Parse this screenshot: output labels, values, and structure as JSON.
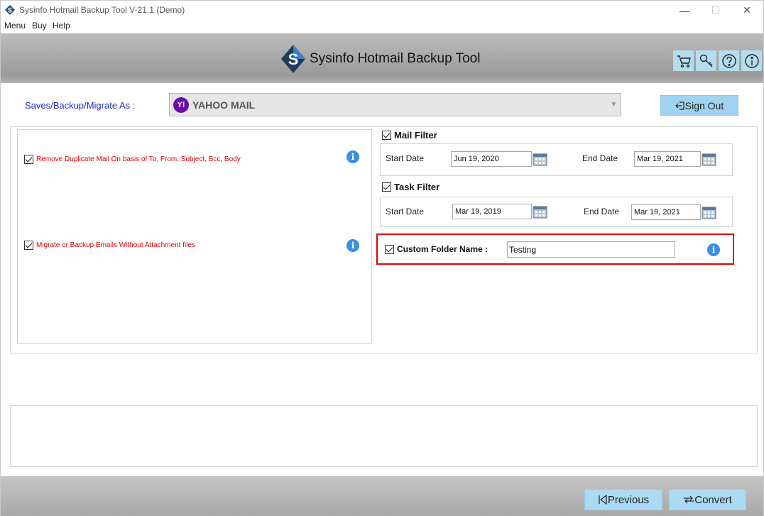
{
  "window": {
    "title": "Sysinfo Hotmail Backup Tool V-21.1 (Demo)",
    "minimize": "—",
    "maximize": "☐",
    "close": "✕"
  },
  "menu": [
    "Menu",
    "Buy",
    "Help"
  ],
  "header": {
    "brand": "Sysinfo Hotmail Backup Tool",
    "buttons": [
      "cart-icon",
      "key-icon",
      "help-icon",
      "info-icon"
    ]
  },
  "saves": {
    "label": "Saves/Backup/Migrate As :",
    "selected": "YAHOO MAIL",
    "selected_icon": "Y!"
  },
  "sign_out": "Sign Out",
  "options": {
    "remove_duplicate": "Remove Duplicate Mail On basis of To, From, Subject, Bcc, Body",
    "without_attachment": "Migrate or Backup Emails Without Attachment files"
  },
  "mail_filter": {
    "title": "Mail Filter",
    "start_label": "Start Date",
    "start_value": "Jun 19, 2020",
    "end_label": "End Date",
    "end_value": "Mar 19, 2021"
  },
  "task_filter": {
    "title": "Task Filter",
    "start_label": "Start Date",
    "start_value": "Mar 19, 2019",
    "end_label": "End Date",
    "end_value": "Mar 19, 2021"
  },
  "custom_folder": {
    "label": "Custom Folder Name :",
    "value": "Testing"
  },
  "info_glyph": "i",
  "footer": {
    "previous": "Previous",
    "convert": "Convert"
  },
  "colors": {
    "accent_button": "#a9dbf2",
    "highlight_border": "#e00000",
    "option_text": "#e00000",
    "label_blue": "#1c2bc7"
  }
}
